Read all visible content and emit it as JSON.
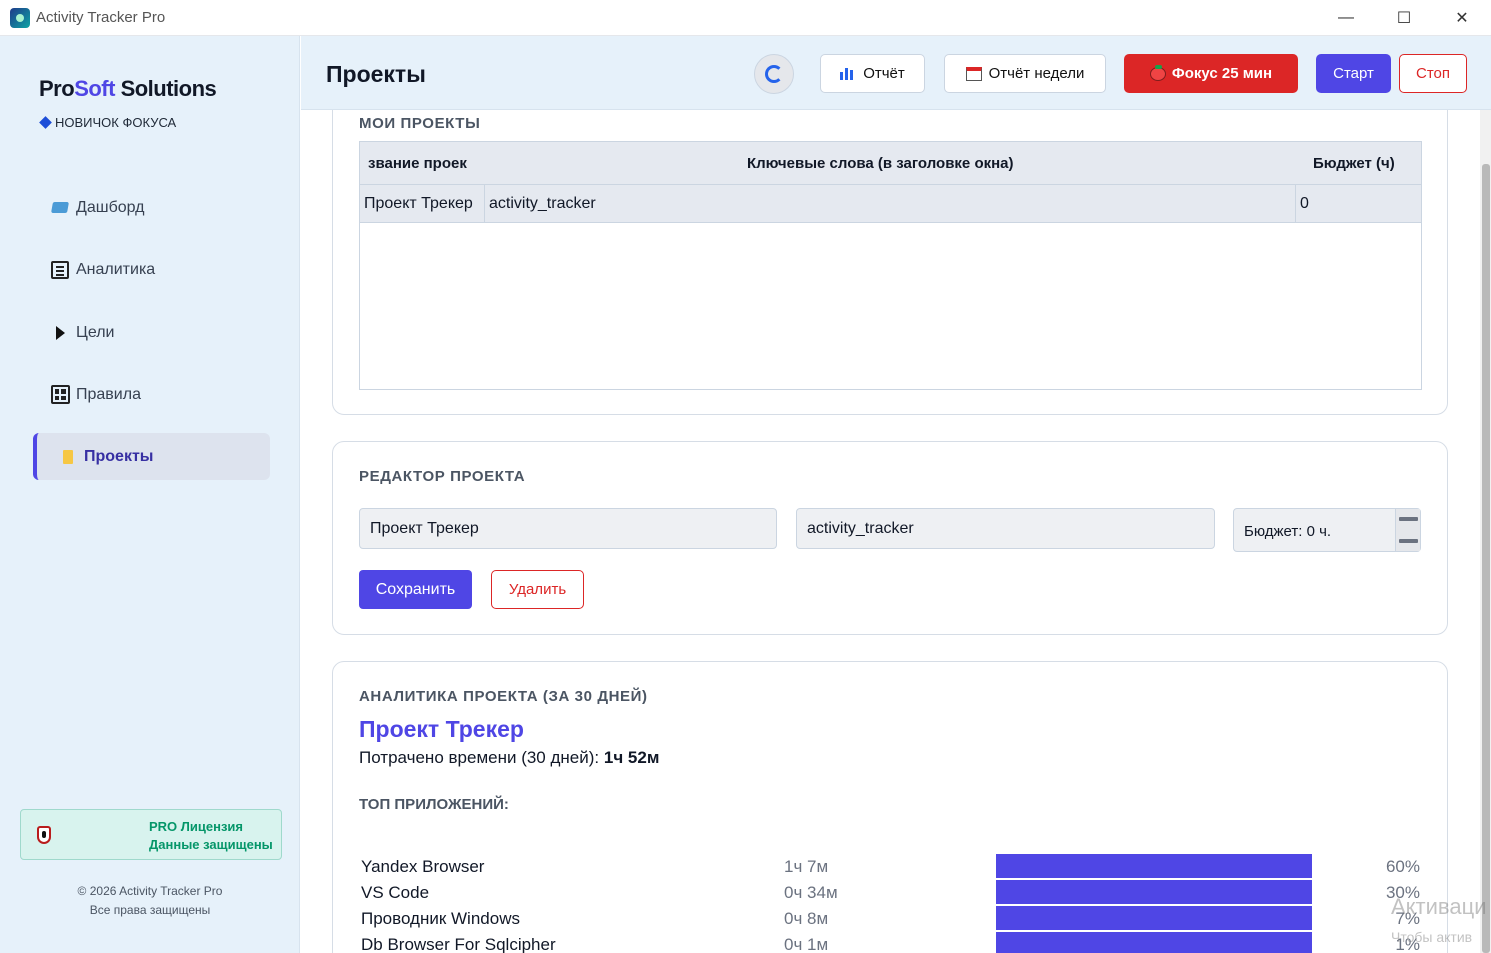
{
  "window": {
    "title": "Activity Tracker Pro",
    "minimize": "—",
    "maximize": "☐",
    "close": "✕"
  },
  "sidebar": {
    "brand_pro": "Pro",
    "brand_soft": "Soft",
    "brand_rest": " Solutions",
    "rank": "НОВИЧОК ФОКУСА",
    "items": [
      {
        "label": "Дашборд",
        "icon": "laptop-icon"
      },
      {
        "label": "Аналитика",
        "icon": "document-icon"
      },
      {
        "label": "Цели",
        "icon": "play-icon"
      },
      {
        "label": "Правила",
        "icon": "grid-icon"
      },
      {
        "label": "Проекты",
        "icon": "folder-icon",
        "active": true
      }
    ],
    "license_line1": "PRO Лицензия",
    "license_line2": "Данные защищены",
    "copyright": "© 2026 Activity Tracker Pro",
    "rights": "Все права защищены"
  },
  "header": {
    "title": "Проекты",
    "report": "Отчёт",
    "week_report": "Отчёт недели",
    "focus": "Фокус 25 мин",
    "start": "Старт",
    "stop": "Стоп"
  },
  "projects": {
    "section_title": "МОИ ПРОЕКТЫ",
    "columns": [
      "звание проек",
      "Ключевые слова (в заголовке окна)",
      "Бюджет (ч)"
    ],
    "rows": [
      {
        "name": "Проект Трекер",
        "keywords": "activity_tracker",
        "budget": "0"
      }
    ]
  },
  "editor": {
    "section_title": "РЕДАКТОР ПРОЕКТА",
    "name_value": "Проект Трекер",
    "keywords_value": "activity_tracker",
    "budget_value": "Бюджет: 0 ч.",
    "save": "Сохранить",
    "delete": "Удалить"
  },
  "analytics": {
    "section_title": "АНАЛИТИКА ПРОЕКТА (ЗА 30 ДНЕЙ)",
    "project": "Проект Трекер",
    "spent_label": "Потрачено времени (30 дней): ",
    "spent_value": "1ч 52м",
    "top_title": "ТОП ПРИЛОЖЕНИЙ:",
    "apps": [
      {
        "name": "Yandex Browser",
        "time": "1ч 7м",
        "percent": "60%",
        "fill": 1.0
      },
      {
        "name": "VS Code",
        "time": "0ч 34м",
        "percent": "30%",
        "fill": 1.0
      },
      {
        "name": "Проводник Windows",
        "time": "0ч 8м",
        "percent": "7%",
        "fill": 1.0
      },
      {
        "name": "Db Browser For Sqlcipher",
        "time": "0ч 1м",
        "percent": "1%",
        "fill": 1.0
      }
    ]
  },
  "watermark": {
    "line1": "Активаци",
    "line2": "Чтобы актив"
  }
}
